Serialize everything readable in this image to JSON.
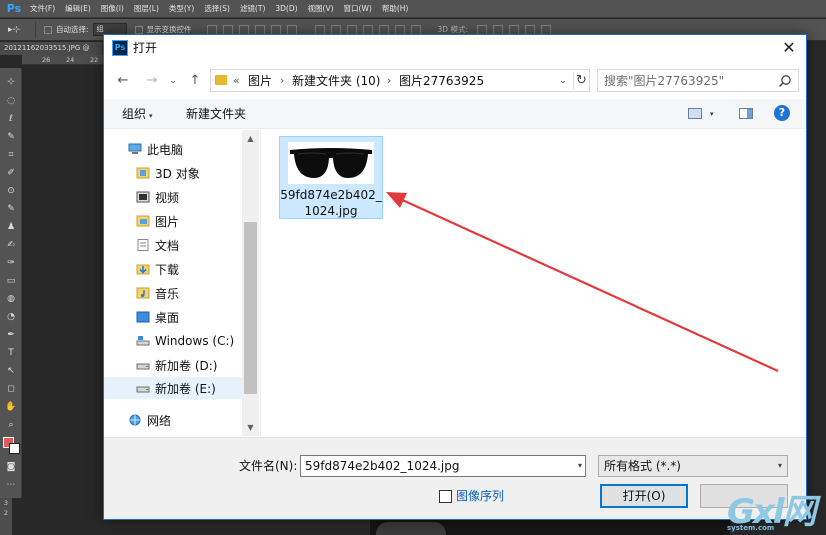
{
  "photoshop": {
    "logo": "Ps",
    "menu": [
      "文件(F)",
      "编辑(E)",
      "图像(I)",
      "图层(L)",
      "类型(Y)",
      "选择(S)",
      "滤镜(T)",
      "3D(D)",
      "视图(V)",
      "窗口(W)",
      "帮助(H)"
    ],
    "options": {
      "tool_glyph": "▸⊹",
      "auto_select_label": "自动选择:",
      "auto_select_value": "组",
      "show_transform_label": "显示变换控件",
      "mode_3d_label": "3D 模式:"
    },
    "doc_tab": "20121162033515.JPG @",
    "ruler_numbers": [
      "26",
      "24",
      "22"
    ],
    "vruler_numbers": [
      "3",
      "2"
    ],
    "tool_glyphs": [
      "⊹",
      "◌",
      "ℓ",
      "✎",
      "⌗",
      "✐",
      "⊙",
      "✎",
      "♟",
      "✍",
      "✑",
      "▭",
      "◍",
      "◔",
      "✒",
      "T",
      "↖",
      "◻",
      "✋",
      "⌕",
      "⋯"
    ],
    "foreground_color": "#e05a5a",
    "background_color": "#ffffff"
  },
  "dialog": {
    "icon_label": "Ps",
    "title": "打开",
    "close_icon": "✕",
    "nav": {
      "back_icon": "←",
      "forward_icon": "→",
      "recent_icon": "⌄",
      "up_icon": "↑"
    },
    "address": {
      "overflow": "«",
      "segments": [
        "图片",
        "新建文件夹 (10)",
        "图片27763925"
      ],
      "separator": "›",
      "dropdown_icon": "⌄",
      "refresh_icon": "↻"
    },
    "search_placeholder": "搜索\"图片27763925\"",
    "commands": {
      "organize": "组织",
      "organize_arrow": "▾",
      "new_folder": "新建文件夹",
      "view_arrow": "▾",
      "help": "?"
    },
    "tree": [
      {
        "label": "此电脑",
        "icon": "computer-icon"
      },
      {
        "label": "3D 对象",
        "icon": "3d-objects-icon"
      },
      {
        "label": "视频",
        "icon": "video-icon"
      },
      {
        "label": "图片",
        "icon": "pictures-icon"
      },
      {
        "label": "文档",
        "icon": "documents-icon"
      },
      {
        "label": "下载",
        "icon": "download-icon"
      },
      {
        "label": "音乐",
        "icon": "music-icon"
      },
      {
        "label": "桌面",
        "icon": "desktop-icon"
      },
      {
        "label": "Windows (C:)",
        "icon": "drive-c-icon"
      },
      {
        "label": "新加卷 (D:)",
        "icon": "drive-icon"
      },
      {
        "label": "新加卷 (E:)",
        "icon": "drive-icon"
      },
      {
        "label": "网络",
        "icon": "network-icon"
      }
    ],
    "scroll": {
      "up": "▲",
      "down": "▼"
    },
    "file": {
      "name": "59fd874e2b402_1024.jpg",
      "thumbnail": "sunglasses-thumbnail"
    },
    "bottom": {
      "filename_label": "文件名(N):",
      "filename_value": "59fd874e2b402_1024.jpg",
      "filename_drop": "▾",
      "filetype_value": "所有格式 (*.*)",
      "filetype_drop": "▾",
      "image_sequence_label": "图像序列",
      "open_button": "打开(O)",
      "cancel_button": ""
    }
  },
  "annotation": {
    "arrow_color": "#e03a3a"
  },
  "watermark": {
    "big": "Gxl网",
    "small": "system.com"
  }
}
